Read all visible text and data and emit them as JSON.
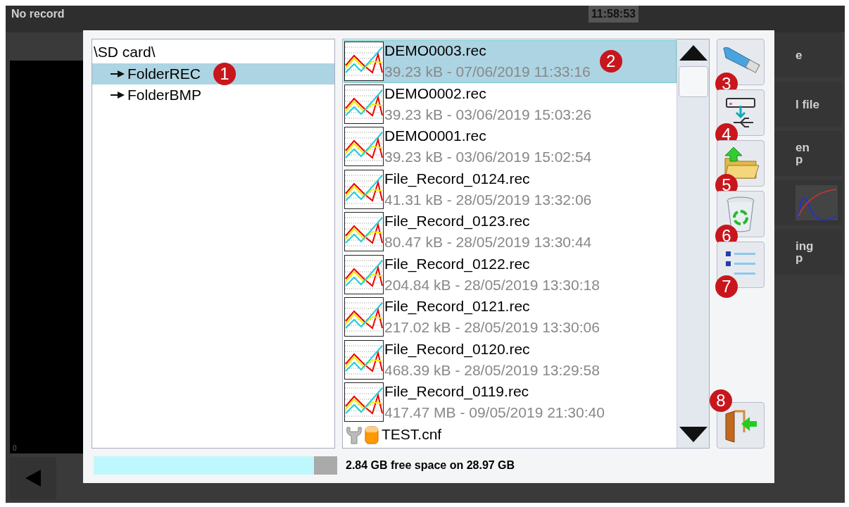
{
  "background": {
    "status": "No record",
    "clock": "11:58:53",
    "axis_label": "0",
    "side_buttons": [
      {
        "kind": "text",
        "lines": [
          "e"
        ]
      },
      {
        "kind": "text",
        "lines": [
          "l file"
        ]
      },
      {
        "kind": "text",
        "lines": [
          "en",
          "p"
        ]
      },
      {
        "kind": "chart"
      },
      {
        "kind": "text",
        "lines": [
          "ing",
          "p"
        ]
      }
    ]
  },
  "tree": {
    "root": "\\SD card\\",
    "items": [
      {
        "label": "FolderREC",
        "selected": true,
        "badge": "1"
      },
      {
        "label": "FolderBMP",
        "selected": false
      }
    ]
  },
  "files": [
    {
      "kind": "rec",
      "name": "DEMO0003.rec",
      "info": "39.23 kB - 07/06/2019 11:33:16",
      "selected": true,
      "badge": "2"
    },
    {
      "kind": "rec",
      "name": "DEMO0002.rec",
      "info": "39.23 kB - 03/06/2019 15:03:26",
      "selected": false
    },
    {
      "kind": "rec",
      "name": "DEMO0001.rec",
      "info": "39.23 kB - 03/06/2019 15:02:54",
      "selected": false
    },
    {
      "kind": "rec",
      "name": "File_Record_0124.rec",
      "info": "41.31 kB - 28/05/2019 13:32:06",
      "selected": false
    },
    {
      "kind": "rec",
      "name": "File_Record_0123.rec",
      "info": "80.47 kB - 28/05/2019 13:30:44",
      "selected": false
    },
    {
      "kind": "rec",
      "name": "File_Record_0122.rec",
      "info": "204.84 kB - 28/05/2019 13:30:18",
      "selected": false
    },
    {
      "kind": "rec",
      "name": "File_Record_0121.rec",
      "info": "217.02 kB - 28/05/2019 13:30:06",
      "selected": false
    },
    {
      "kind": "rec",
      "name": "File_Record_0120.rec",
      "info": "468.39 kB - 28/05/2019 13:29:58",
      "selected": false
    },
    {
      "kind": "rec",
      "name": "File_Record_0119.rec",
      "info": "417.47 MB - 09/05/2019 21:30:40",
      "selected": false
    },
    {
      "kind": "cnf",
      "name": "TEST.cnf",
      "selected": false
    }
  ],
  "actions": [
    {
      "kind": "usb",
      "badge": "3"
    },
    {
      "kind": "transfer",
      "badge": "4"
    },
    {
      "kind": "folder-up",
      "badge": "5"
    },
    {
      "kind": "trash",
      "badge": "6"
    },
    {
      "kind": "list",
      "badge": "7"
    }
  ],
  "exit": {
    "badge": "8"
  },
  "storage": {
    "level": 0.905,
    "text": "2.84 GB free space on 28.97 GB"
  }
}
